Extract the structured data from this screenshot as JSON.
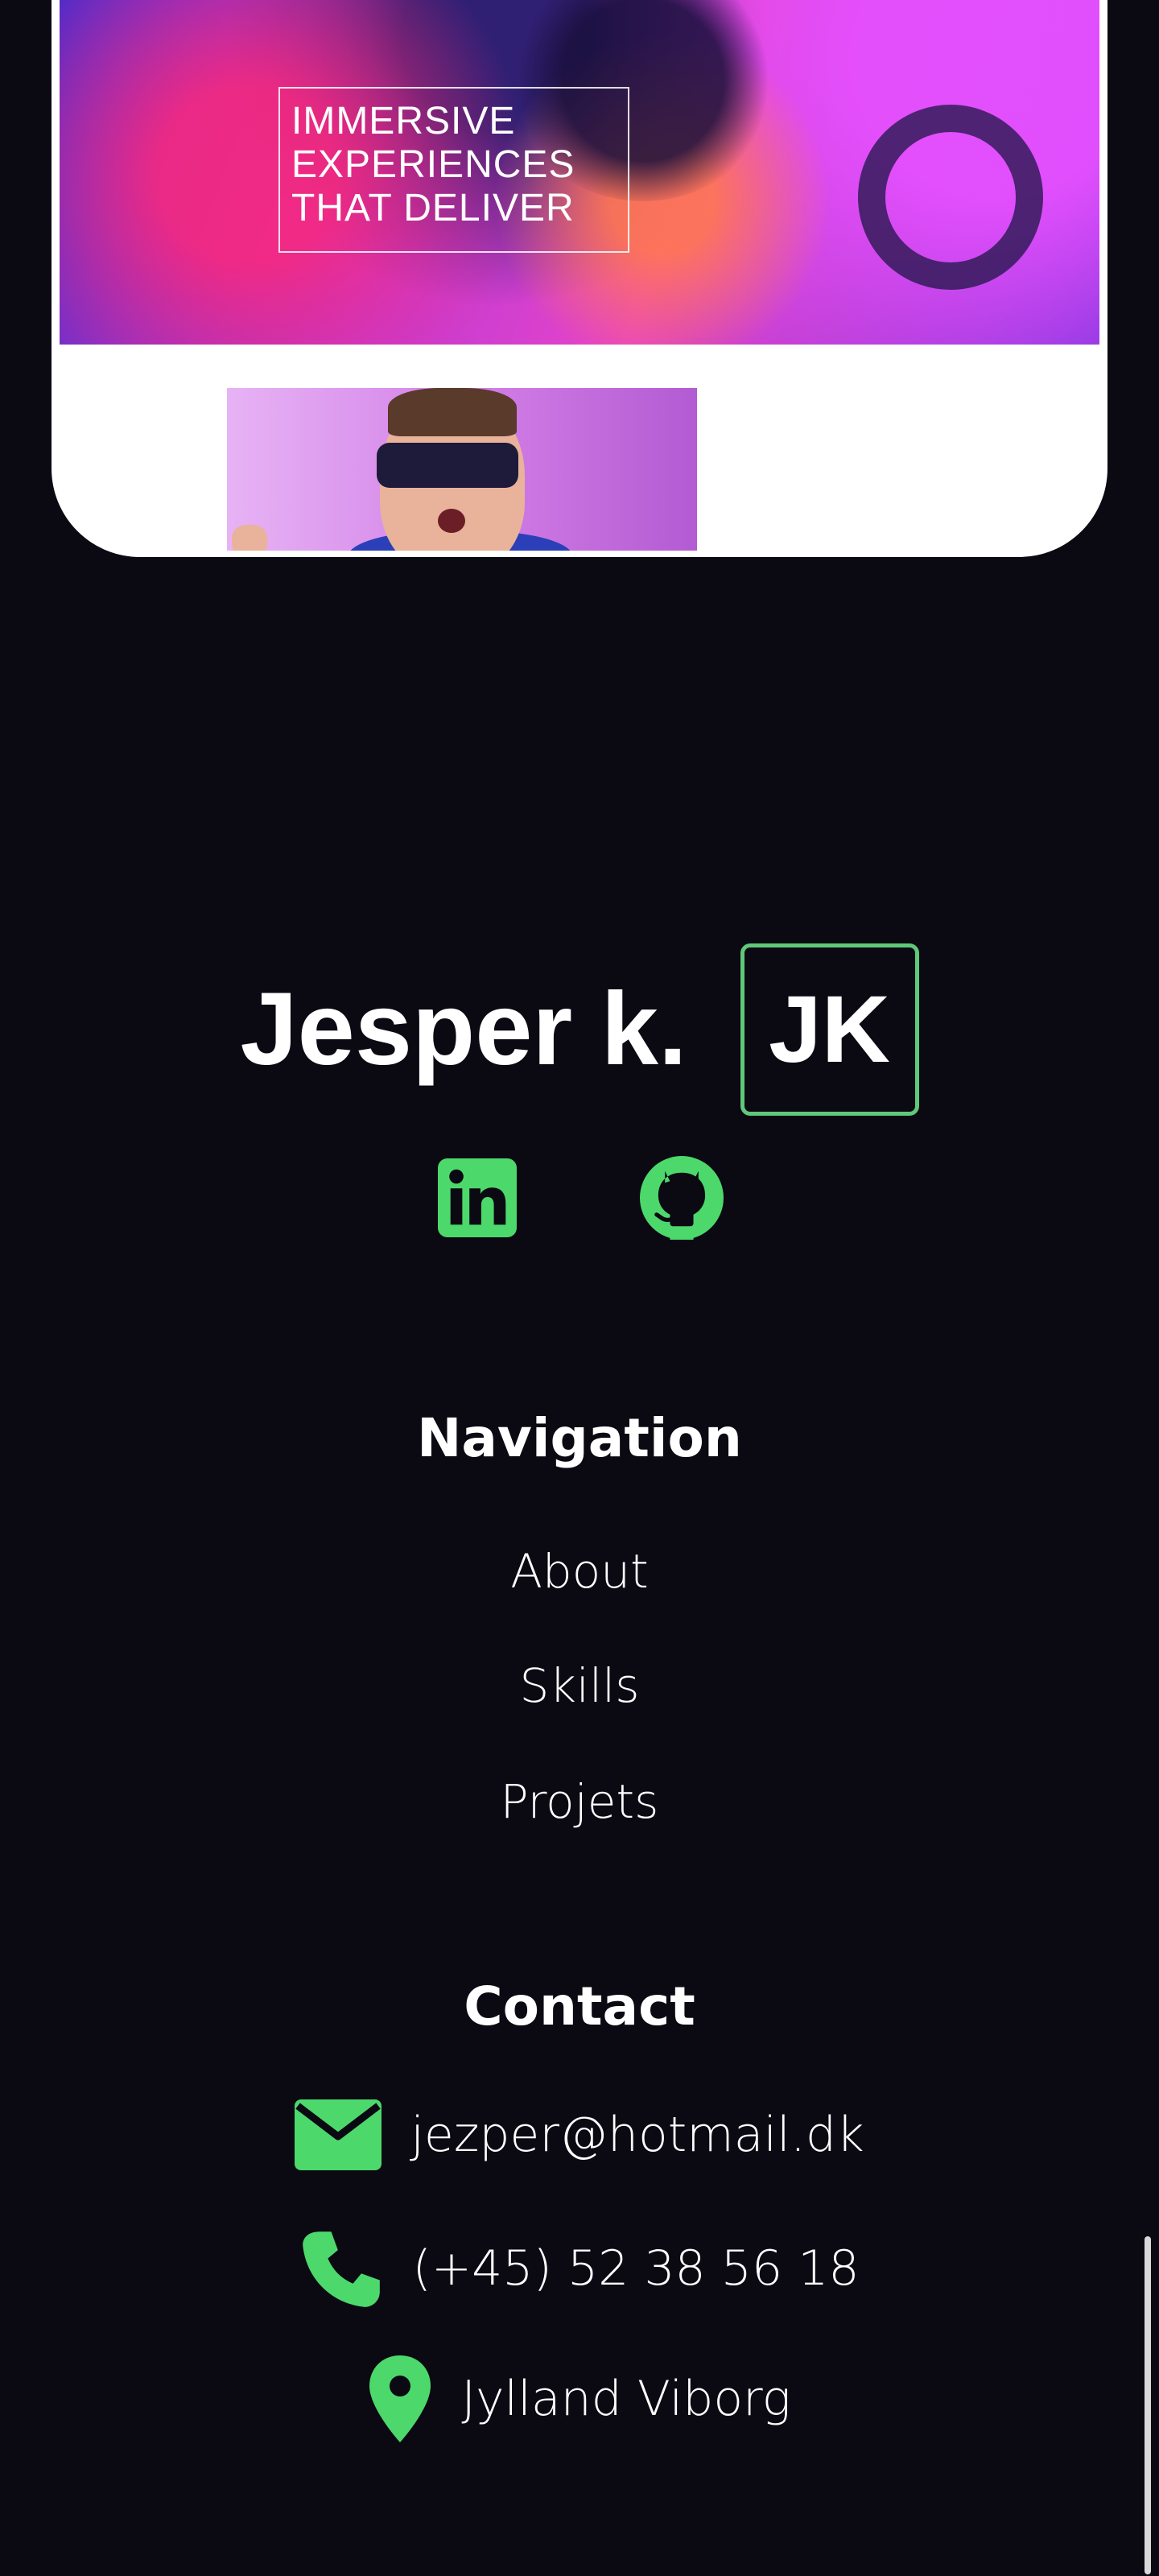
{
  "project_card": {
    "hero_title_lines": [
      "IMMERSIVE",
      "EXPERIENCES",
      "THAT DELIVER"
    ]
  },
  "brand": {
    "name": "Jesper k.",
    "logo_text": "JK"
  },
  "socials": [
    {
      "name": "linkedin",
      "icon": "linkedin-icon"
    },
    {
      "name": "github",
      "icon": "github-icon"
    }
  ],
  "navigation": {
    "title": "Navigation",
    "links": [
      "About",
      "Skills",
      "Projets"
    ]
  },
  "contact": {
    "title": "Contact",
    "email": "jezper@hotmail.dk",
    "phone": "(+45) 52 38 56 18",
    "location": "Jylland Viborg"
  },
  "colors": {
    "background": "#0b0a13",
    "accent": "#5fc879",
    "icon_green": "#4dd86c",
    "text": "#ffffff"
  }
}
